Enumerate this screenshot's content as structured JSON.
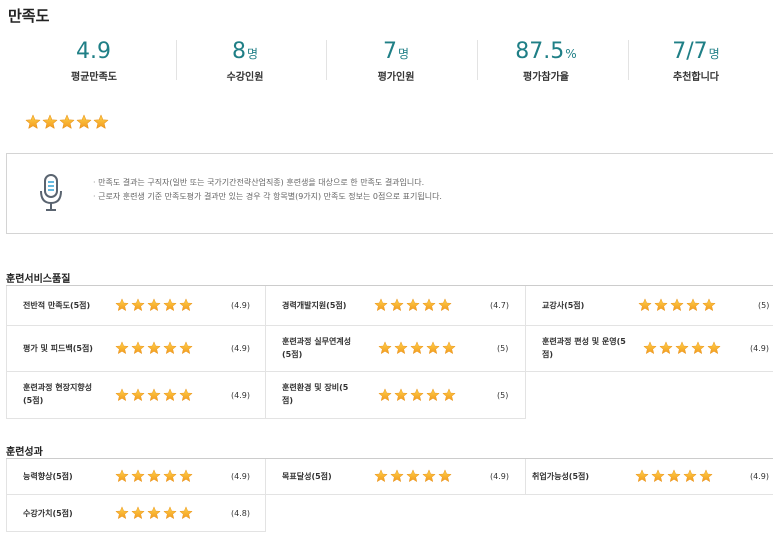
{
  "page": {
    "title": "만족도"
  },
  "stats": [
    {
      "name": "stat-average-satisfaction",
      "value": "4.9",
      "unit": "",
      "label": "평균만족도"
    },
    {
      "name": "stat-enrolled",
      "value": "8",
      "unit": "명",
      "label": "수강인원"
    },
    {
      "name": "stat-rated",
      "value": "7",
      "unit": "명",
      "label": "평가인원"
    },
    {
      "name": "stat-participation-rate",
      "value": "87.5",
      "unit": "%",
      "label": "평가참가율"
    },
    {
      "name": "stat-recommend",
      "value": "7/7",
      "unit": "명",
      "label": "추천합니다"
    }
  ],
  "overall_rating": {
    "stars": 5
  },
  "notice": {
    "icon": "microphone-icon",
    "lines": [
      "만족도 결과는 구직자(일반 또는 국가기간전략산업직종) 훈련생을 대상으로 한 만족도 결과입니다.",
      "근로자 훈련생 기준 만족도평가 결과만 있는 경우 각 항목별(9가지) 만족도 정보는 0점으로 표기됩니다."
    ]
  },
  "sections": [
    {
      "title": "훈련서비스품질",
      "items": [
        {
          "label": "전반적 만족도(5점)",
          "stars": 5,
          "score": "(4.9)"
        },
        {
          "label": "경력개발지원(5점)",
          "stars": 5,
          "score": "(4.7)"
        },
        {
          "label": "교강사(5점)",
          "stars": 5,
          "score": "(5)"
        },
        {
          "label": "평가 및 피드백(5점)",
          "stars": 5,
          "score": "(4.9)"
        },
        {
          "label": "훈련과정 실무연계성(5점)",
          "stars": 5,
          "score": "(5)"
        },
        {
          "label": "훈련과정 편성 및 운영(5점)",
          "stars": 5,
          "score": "(4.9)"
        },
        {
          "label": "훈련과정 현장지향성(5점)",
          "stars": 5,
          "score": "(4.9)"
        },
        {
          "label": "훈련환경 및 장비(5점)",
          "stars": 5,
          "score": "(5)"
        }
      ]
    },
    {
      "title": "훈련성과",
      "items": [
        {
          "label": "능력향상(5점)",
          "stars": 5,
          "score": "(4.9)"
        },
        {
          "label": "목표달성(5점)",
          "stars": 5,
          "score": "(4.9)"
        },
        {
          "label": "취업가능성(5점)",
          "stars": 5,
          "score": "(4.9)"
        },
        {
          "label": "수강가치(5점)",
          "stars": 5,
          "score": "(4.8)"
        }
      ]
    }
  ],
  "colors": {
    "accent": "#1f7f86",
    "star_top": "#ffd24a",
    "star_bottom": "#f29a1e"
  }
}
